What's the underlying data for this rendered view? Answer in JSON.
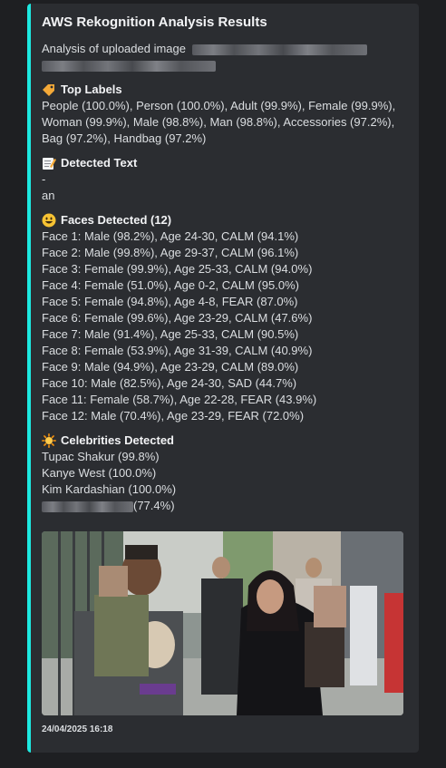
{
  "embed": {
    "accent_color": "#1de9e1",
    "title": "AWS Rekognition Analysis Results",
    "description_prefix": "Analysis of uploaded image",
    "top_labels": {
      "icon": "label-tag-icon",
      "name": "Top Labels",
      "value": "People (100.0%), Person (100.0%), Adult (99.9%), Female (99.9%), Woman (99.9%), Male (98.8%), Man (98.8%), Accessories (97.2%), Bag (97.2%), Handbag (97.2%)"
    },
    "detected_text": {
      "icon": "memo-icon",
      "name": "Detected Text",
      "lines": [
        "-",
        "an"
      ]
    },
    "faces": {
      "icon": "smiley-icon",
      "name": "Faces Detected (12)",
      "lines": [
        "Face 1: Male (98.2%), Age 24-30, CALM (94.1%)",
        "Face 2: Male (99.8%), Age 29-37, CALM (96.1%)",
        "Face 3: Female (99.9%), Age 25-33, CALM (94.0%)",
        "Face 4: Female (51.0%), Age 0-2, CALM (95.0%)",
        "Face 5: Female (94.8%), Age 4-8, FEAR (87.0%)",
        "Face 6: Female (99.6%), Age 23-29, CALM (47.6%)",
        "Face 7: Male (91.4%), Age 25-33, CALM (90.5%)",
        "Face 8: Female (53.9%), Age 31-39, CALM (40.9%)",
        "Face 9: Male (94.9%), Age 23-29, CALM (89.0%)",
        "Face 10: Male (82.5%), Age 24-30, SAD (44.7%)",
        "Face 11: Female (58.7%), Age 22-28, FEAR (43.9%)",
        "Face 12: Male (70.4%), Age 23-29, FEAR (72.0%)"
      ]
    },
    "celebrities": {
      "icon": "sun-icon",
      "name": "Celebrities Detected",
      "lines": [
        "Tupac Shakur (99.8%)",
        "Kanye West (100.0%)",
        "Kim Kardashian (100.0%)"
      ],
      "redacted_line_suffix": "(77.4%)"
    },
    "timestamp": "24/04/2025 16:18"
  }
}
